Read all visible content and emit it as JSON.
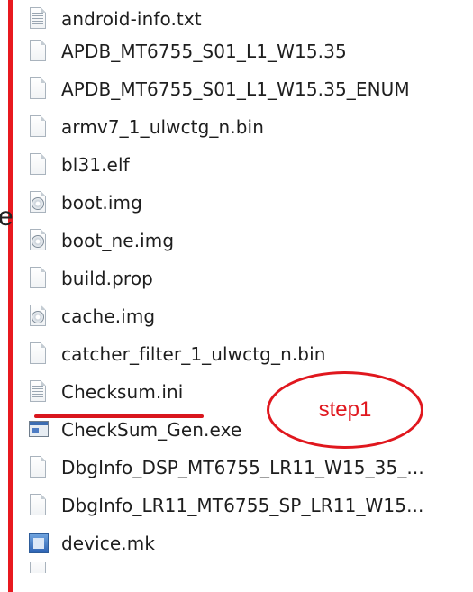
{
  "files": [
    {
      "name": "android-info.txt",
      "icon": "text-file-icon"
    },
    {
      "name": "APDB_MT6755_S01_L1_W15.35",
      "icon": "file-icon"
    },
    {
      "name": "APDB_MT6755_S01_L1_W15.35_ENUM",
      "icon": "file-icon"
    },
    {
      "name": "armv7_1_ulwctg_n.bin",
      "icon": "file-icon"
    },
    {
      "name": "bl31.elf",
      "icon": "file-icon"
    },
    {
      "name": "boot.img",
      "icon": "disc-image-icon"
    },
    {
      "name": "boot_ne.img",
      "icon": "disc-image-icon"
    },
    {
      "name": "build.prop",
      "icon": "file-icon"
    },
    {
      "name": "cache.img",
      "icon": "disc-image-icon"
    },
    {
      "name": "catcher_filter_1_ulwctg_n.bin",
      "icon": "file-icon"
    },
    {
      "name": "Checksum.ini",
      "icon": "ini-file-icon"
    },
    {
      "name": "CheckSum_Gen.exe",
      "icon": "exe-icon"
    },
    {
      "name": "DbgInfo_DSP_MT6755_LR11_W15_35_...",
      "icon": "file-icon"
    },
    {
      "name": "DbgInfo_LR11_MT6755_SP_LR11_W15...",
      "icon": "file-icon"
    },
    {
      "name": "device.mk",
      "icon": "mk-file-icon"
    }
  ],
  "stray_char": "e",
  "annotation": {
    "label": "step1",
    "color": "#e0171e"
  },
  "colors": {
    "border": "#e8191f",
    "underline": "#d9161d"
  }
}
